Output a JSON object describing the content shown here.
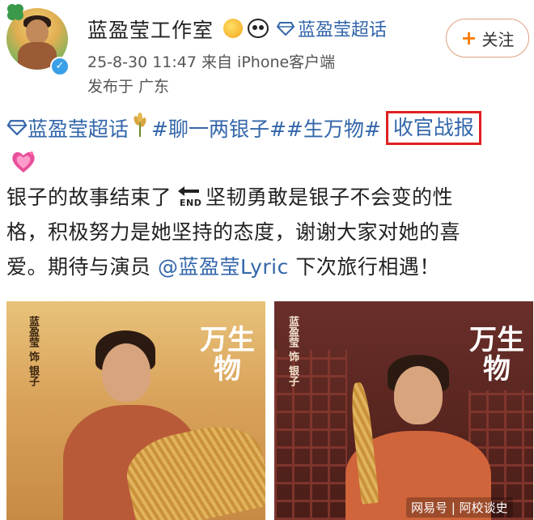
{
  "account": {
    "name": "蓝盈莹工作室",
    "super_topic": "蓝盈莹超话",
    "follow_label": "关注",
    "timestamp": "25-8-30 11:47",
    "source": "来自 iPhone客户端",
    "location": "发布于 广东",
    "badges": [
      "crown-icon",
      "panda-icon",
      "diamond-icon"
    ]
  },
  "post": {
    "topic_link": "蓝盈莹超话",
    "hashtag1": "#聊一两银子#",
    "hashtag2": "#生万物#",
    "boxed_text": "收官战报",
    "line1": "银子的故事结束了",
    "line1b": "坚韧勇敢是银子不会变的性",
    "line2": "格，积极努力是她坚持的态度，谢谢大家对她的喜",
    "line3a": "爱。期待与演员",
    "mention": "@蓝盈莹Lyric",
    "line3b": "下次旅行相遇！"
  },
  "posters": [
    {
      "credit": "蓝盈莹 饰 银子",
      "title": "万生物"
    },
    {
      "credit": "蓝盈莹 饰 银子",
      "title": "万生物"
    }
  ],
  "watermark": "网易号 | 阿校谈史",
  "colors": {
    "link": "#3366aa",
    "highlight_box": "#e02020",
    "follow_plus": "#ff7a00",
    "verified": "#3aa0e8"
  }
}
